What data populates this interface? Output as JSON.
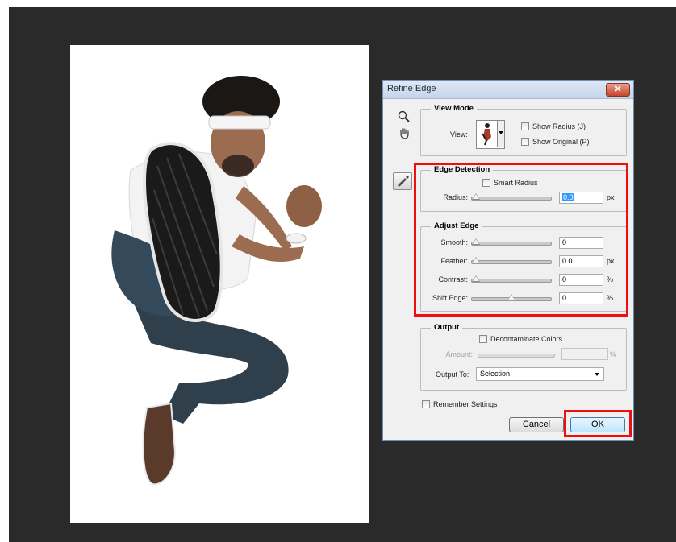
{
  "dialog": {
    "title": "Refine Edge",
    "close_symbol": "✕",
    "tools": [
      "zoom-tool-icon",
      "hand-tool-icon",
      "refine-radius-brush-icon"
    ]
  },
  "view_mode": {
    "legend": "View Mode",
    "view_label": "View:",
    "show_radius": "Show Radius (J)",
    "show_original": "Show Original (P)"
  },
  "edge_detection": {
    "legend": "Edge Detection",
    "smart_radius": "Smart Radius",
    "radius": {
      "label": "Radius:",
      "value": "0.0",
      "unit": "px",
      "level": 0
    }
  },
  "adjust_edge": {
    "legend": "Adjust Edge",
    "smooth": {
      "label": "Smooth:",
      "value": "0",
      "unit": "",
      "level": 0
    },
    "feather": {
      "label": "Feather:",
      "value": "0.0",
      "unit": "px",
      "level": 0
    },
    "contrast": {
      "label": "Contrast:",
      "value": "0",
      "unit": "%",
      "level": 0
    },
    "shift_edge": {
      "label": "Shift Edge:",
      "value": "0",
      "unit": "%",
      "level": 0.5
    }
  },
  "output": {
    "legend": "Output",
    "decontaminate": "Decontaminate Colors",
    "amount": {
      "label": "Amount:",
      "value": "",
      "unit": "%"
    },
    "output_to_label": "Output To:",
    "output_to_value": "Selection"
  },
  "remember_settings": "Remember Settings",
  "buttons": {
    "cancel": "Cancel",
    "ok": "OK"
  },
  "colors": {
    "highlight": "#ee1010",
    "workspace": "#2a2a2a",
    "dialog_bg": "#f0f0f0"
  }
}
